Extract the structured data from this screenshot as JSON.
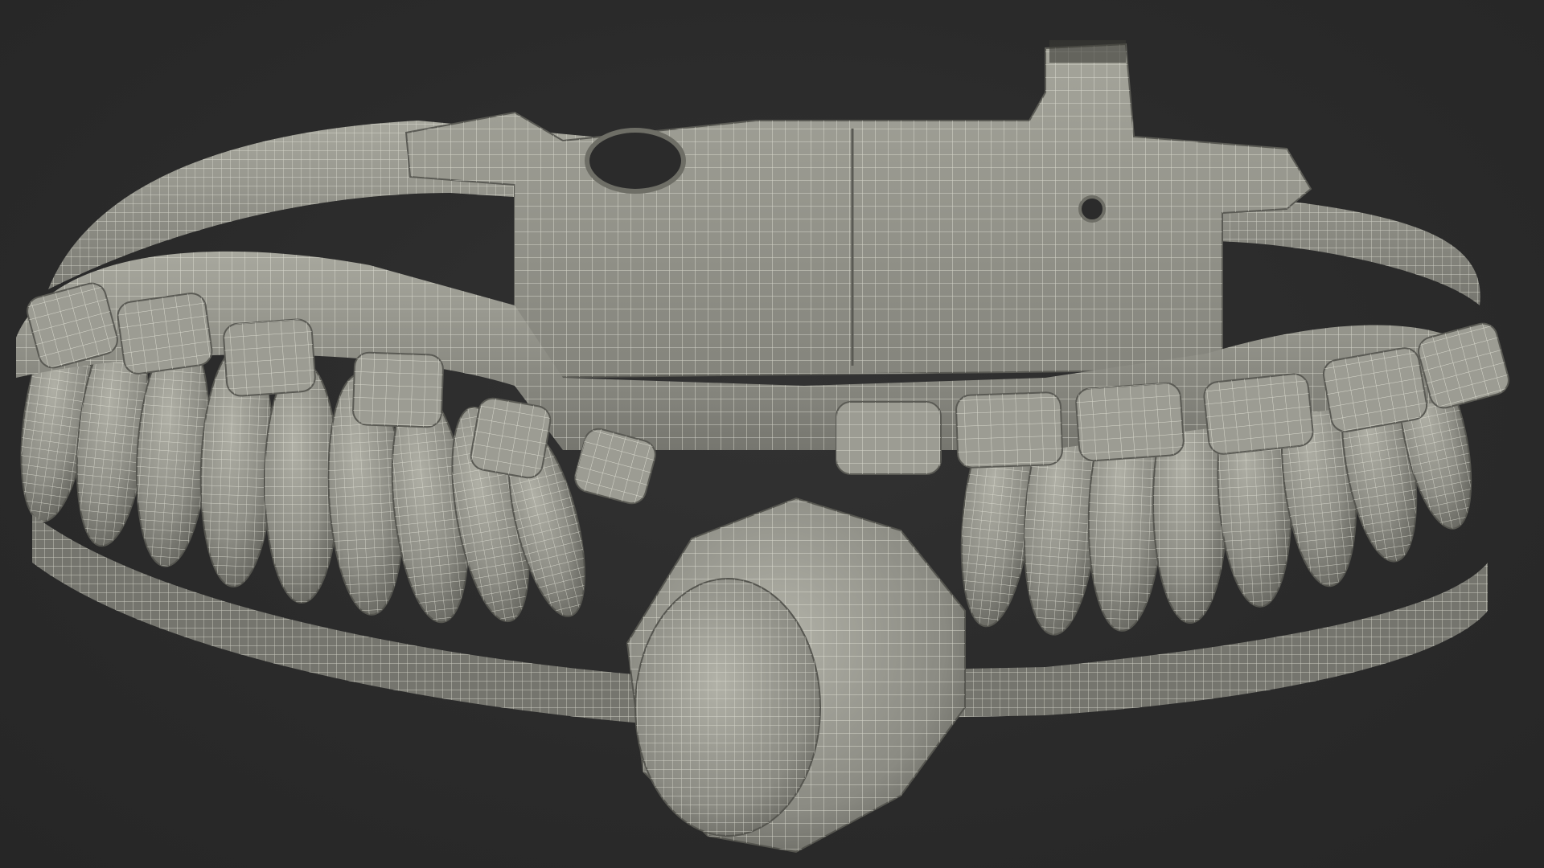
{
  "scene": {
    "subject": "paracord-bracelet-wireframe-render",
    "colors": {
      "background": "#2b2b2b",
      "surface": "#8f8f87",
      "surface_light": "#b4b4aa",
      "surface_dark": "#5e5e58",
      "wire": "#e4e4d8"
    }
  }
}
